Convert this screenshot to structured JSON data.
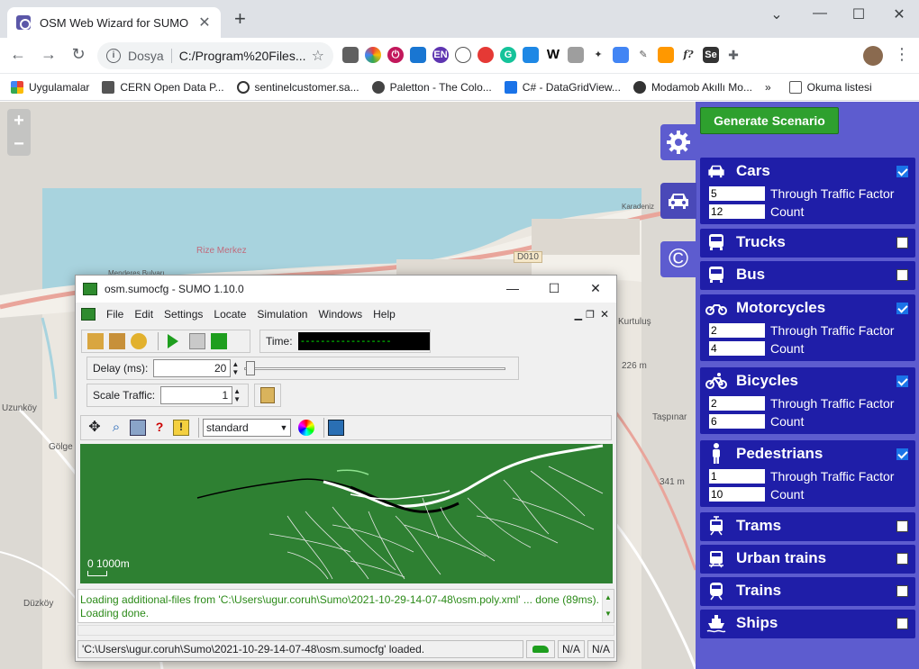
{
  "browser": {
    "tab_title": "OSM Web Wizard for SUMO",
    "site_label": "Dosya",
    "url": "C:/Program%20Files...",
    "bookmarks": [
      "Uygulamalar",
      "CERN Open Data P...",
      "sentinelcustomer.sa...",
      "Paletton - The Colo...",
      "C# - DataGridView...",
      "Modamob Akıllı Mo...",
      "»",
      "Okuma listesi"
    ],
    "ext_labels": [
      "EN",
      "f?",
      "Se"
    ]
  },
  "map": {
    "labels": [
      "Uzunköy",
      "Gölge",
      "Düzköy",
      "Kurtuluş",
      "Taşpınar",
      "226 m",
      "341 m",
      "D010",
      "Rize Merkez",
      "Menderes Bulvarı",
      "Karadeniz"
    ]
  },
  "sumo": {
    "title": "osm.sumocfg - SUMO 1.10.0",
    "menu": [
      "File",
      "Edit",
      "Settings",
      "Locate",
      "Simulation",
      "Windows",
      "Help"
    ],
    "time_label": "Time:",
    "time_value": "------------------",
    "delay_label": "Delay (ms):",
    "delay_value": "20",
    "scale_label": "Scale Traffic:",
    "scale_value": "1",
    "view_scheme": "standard",
    "scale_bar": "0    1000m",
    "log": [
      "Loading additional-files from 'C:\\Users\\ugur.coruh\\Sumo\\2021-10-29-14-07-48\\osm.poly.xml' ... done (89ms).",
      "Loading done."
    ],
    "status": "'C:\\Users\\ugur.coruh\\Sumo\\2021-10-29-14-07-48\\osm.sumocfg' loaded.",
    "na1": "N/A",
    "na2": "N/A"
  },
  "panel": {
    "generate_label": "Generate Scenario",
    "factor_label": "Through Traffic Factor",
    "count_label": "Count",
    "vehicles": [
      {
        "name": "Cars",
        "checked": true,
        "factor": "5",
        "count": "12"
      },
      {
        "name": "Trucks",
        "checked": false
      },
      {
        "name": "Bus",
        "checked": false
      },
      {
        "name": "Motorcycles",
        "checked": true,
        "factor": "2",
        "count": "4"
      },
      {
        "name": "Bicycles",
        "checked": true,
        "factor": "2",
        "count": "6"
      },
      {
        "name": "Pedestrians",
        "checked": true,
        "factor": "1",
        "count": "10"
      },
      {
        "name": "Trams",
        "checked": false
      },
      {
        "name": "Urban trains",
        "checked": false
      },
      {
        "name": "Trains",
        "checked": false
      },
      {
        "name": "Ships",
        "checked": false
      }
    ]
  }
}
